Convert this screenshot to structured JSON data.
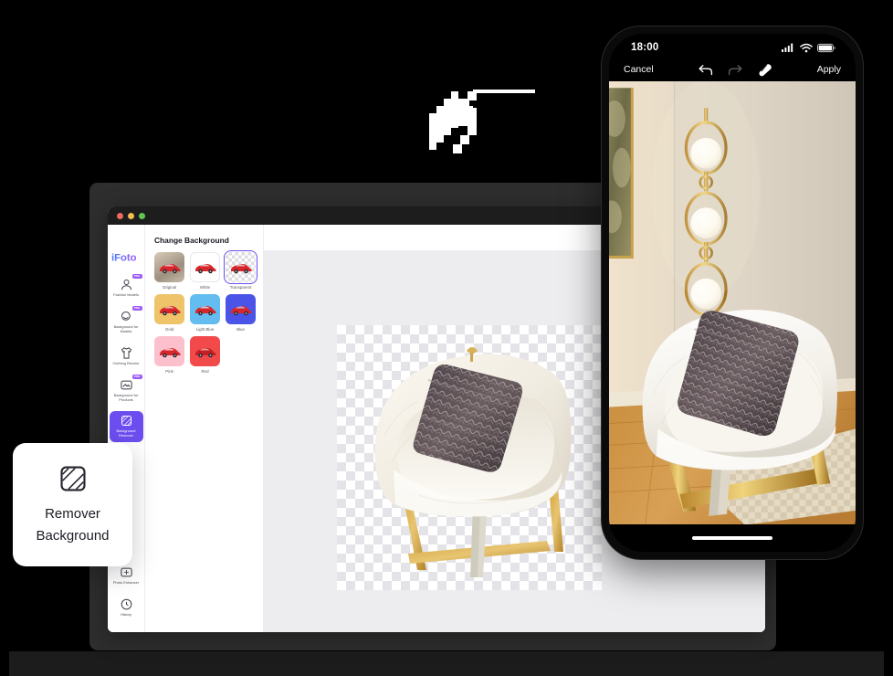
{
  "app": {
    "logo": "iFoto",
    "window_dots": [
      "close",
      "minimize",
      "maximize"
    ]
  },
  "sidebar": {
    "items": [
      {
        "label": "Fashion Models",
        "icon": "fashion-models-icon",
        "badge": "PRO",
        "active": false
      },
      {
        "label": "Background for Models",
        "icon": "background-for-models-icon",
        "badge": "PRO",
        "active": false
      },
      {
        "label": "Clothing Recolor",
        "icon": "clothing-recolor-icon",
        "badge": "",
        "active": false
      },
      {
        "label": "Background for Products",
        "icon": "background-for-products-icon",
        "badge": "PRO",
        "active": false
      },
      {
        "label": "Background Remover",
        "icon": "background-remover-icon",
        "badge": "",
        "active": true
      },
      {
        "label": "Photo Enhancer",
        "icon": "photo-enhancer-icon",
        "badge": "",
        "active": false
      },
      {
        "label": "History",
        "icon": "history-clock-icon",
        "badge": "",
        "active": false
      }
    ]
  },
  "background_panel": {
    "title": "Change Background",
    "swatches": [
      {
        "label": "Original",
        "color": "#c9bba6",
        "kind": "photo",
        "selected": false
      },
      {
        "label": "White",
        "color": "#ffffff",
        "kind": "solid",
        "selected": false
      },
      {
        "label": "Transparent",
        "color": "",
        "kind": "transparent",
        "selected": true
      },
      {
        "label": "Gold",
        "color": "#eec36a",
        "kind": "solid",
        "selected": false
      },
      {
        "label": "Light Blue",
        "color": "#63bdf0",
        "kind": "solid",
        "selected": false
      },
      {
        "label": "Blue",
        "color": "#4a55e8",
        "kind": "solid",
        "selected": false
      },
      {
        "label": "Pink",
        "color": "#fcc0cc",
        "kind": "solid",
        "selected": false
      },
      {
        "label": "Red",
        "color": "#f24a4a",
        "kind": "solid",
        "selected": false
      }
    ]
  },
  "canvas": {
    "subject": "white-fluffy-armchair-with-patterned-pillow",
    "background": "transparent-checkerboard"
  },
  "feature_card": {
    "title_line1": "Remover",
    "title_line2": "Background",
    "icon": "background-remover-hatch-icon"
  },
  "phone": {
    "status": {
      "time": "18:00",
      "icons": [
        "cellular-signal-icon",
        "wifi-icon",
        "battery-icon"
      ]
    },
    "toolbar": {
      "cancel": "Cancel",
      "undo": "undo-arrow-icon",
      "redo": "redo-arrow-icon",
      "eraser": "eraser-icon",
      "apply": "Apply"
    },
    "photo": "armchair-in-room-with-gold-wall-sconce",
    "home_indicator": "home-indicator-bar"
  },
  "colors": {
    "accent": "#6c4ef0",
    "pro_badge": "#9b5cf6",
    "logo_start": "#4a7cf7",
    "logo_end": "#9b5cf6",
    "canvas_bg": "#ededf0",
    "window_chrome": "#1d1d1d"
  }
}
